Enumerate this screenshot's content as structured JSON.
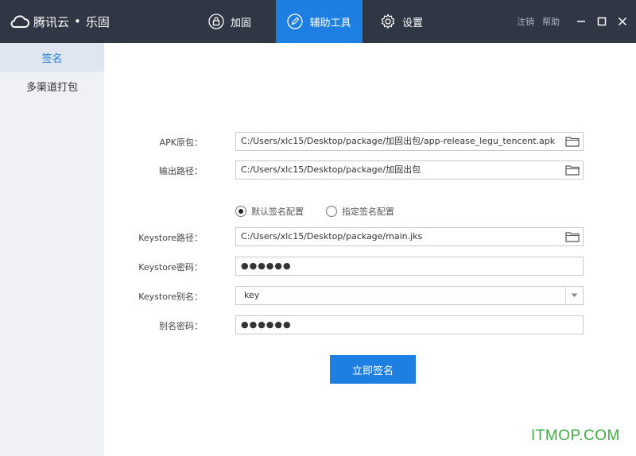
{
  "app": {
    "brand_name": "腾讯云",
    "brand_sep": "•",
    "product": "乐固"
  },
  "nav": {
    "tabs": [
      {
        "label": "加固",
        "icon": "lock-icon",
        "active": false
      },
      {
        "label": "辅助工具",
        "icon": "pencil-icon",
        "active": true
      },
      {
        "label": "设置",
        "icon": "gear-icon",
        "active": false
      }
    ],
    "logout": "注销",
    "help": "帮助"
  },
  "sidebar": {
    "items": [
      {
        "label": "签名",
        "active": true
      },
      {
        "label": "多渠道打包",
        "active": false
      }
    ]
  },
  "form": {
    "apk_label": "APK原包：",
    "apk_value": "C:/Users/xlc15/Desktop/package/加固出包/app-release_legu_tencent.apk",
    "output_label": "输出路径：",
    "output_value": "C:/Users/xlc15/Desktop/package/加固出包",
    "radio_default": "默认签名配置",
    "radio_custom": "指定签名配置",
    "radio_selected": "default",
    "keystore_path_label": "Keystore路径：",
    "keystore_path_value": "C:/Users/xlc15/Desktop/package/main.jks",
    "keystore_pwd_label": "Keystore密码：",
    "keystore_pwd_value": "●●●●●●",
    "keystore_alias_label": "Keystore别名：",
    "keystore_alias_value": "key",
    "alias_pwd_label": "别名密码：",
    "alias_pwd_value": "●●●●●●",
    "sign_button": "立即签名"
  },
  "watermark": "ITMOP.COM",
  "colors": {
    "topbar": "#2f3744",
    "accent": "#1e7fe3",
    "watermark": "#3cb043"
  }
}
